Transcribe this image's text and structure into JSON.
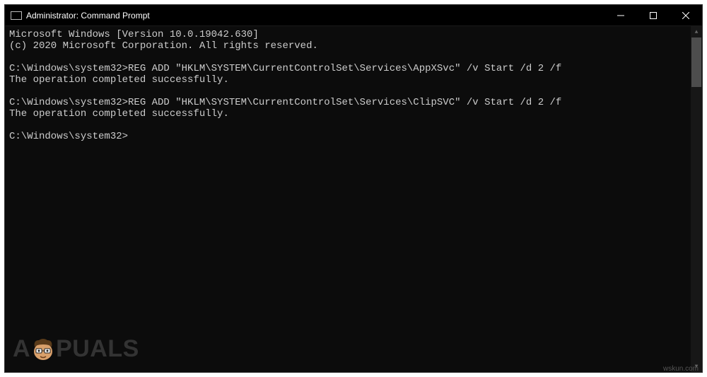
{
  "titlebar": {
    "title": "Administrator: Command Prompt"
  },
  "console": {
    "line1": "Microsoft Windows [Version 10.0.19042.630]",
    "line2": "(c) 2020 Microsoft Corporation. All rights reserved.",
    "blank1": "",
    "prompt1": "C:\\Windows\\system32>REG ADD \"HKLM\\SYSTEM\\CurrentControlSet\\Services\\AppXSvc\" /v Start /d 2 /f",
    "result1": "The operation completed successfully.",
    "blank2": "",
    "prompt2": "C:\\Windows\\system32>REG ADD \"HKLM\\SYSTEM\\CurrentControlSet\\Services\\ClipSVC\" /v Start /d 2 /f",
    "result2": "The operation completed successfully.",
    "blank3": "",
    "prompt3": "C:\\Windows\\system32>"
  },
  "watermark": {
    "pre": "A",
    "post": "PUALS",
    "src": "wskun.com"
  }
}
